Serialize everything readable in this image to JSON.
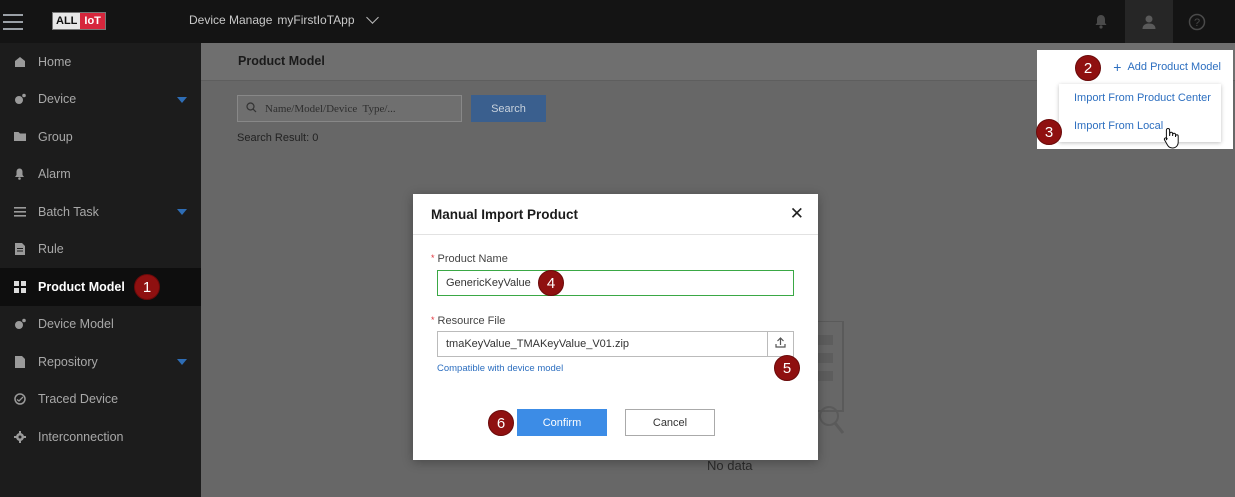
{
  "header": {
    "logo_left": "ALL",
    "logo_right": "IoT",
    "section": "Device Manage",
    "app_name": "myFirstIoTApp"
  },
  "sidebar": {
    "items": [
      {
        "label": "Home",
        "icon": "home-icon"
      },
      {
        "label": "Device",
        "icon": "device-icon",
        "expandable": true
      },
      {
        "label": "Group",
        "icon": "folder-icon"
      },
      {
        "label": "Alarm",
        "icon": "bell-icon"
      },
      {
        "label": "Batch Task",
        "icon": "list-icon",
        "expandable": true
      },
      {
        "label": "Rule",
        "icon": "document-icon"
      },
      {
        "label": "Product Model",
        "icon": "grid-icon",
        "active": true
      },
      {
        "label": "Device Model",
        "icon": "device-model-icon"
      },
      {
        "label": "Repository",
        "icon": "repository-icon",
        "expandable": true
      },
      {
        "label": "Traced Device",
        "icon": "trace-icon"
      },
      {
        "label": "Interconnection",
        "icon": "gear-icon"
      }
    ]
  },
  "main": {
    "page_title": "Product Model",
    "search_placeholder": "Name/Model/Device  Type/...",
    "search_button": "Search",
    "search_result": "Search Result: 0",
    "no_data": "No data"
  },
  "add_menu": {
    "add_label": "Add Product Model",
    "items": [
      "Import From Product Center",
      "Import From Local"
    ]
  },
  "modal": {
    "title": "Manual Import Product",
    "product_name_label": "Product Name",
    "product_name_value": "GenericKeyValue",
    "resource_file_label": "Resource File",
    "resource_file_value": "tmaKeyValue_TMAKeyValue_V01.zip",
    "hint": "Compatible with device model",
    "confirm": "Confirm",
    "cancel": "Cancel"
  },
  "markers": [
    "1",
    "2",
    "3",
    "4",
    "5",
    "6"
  ],
  "colors": {
    "accent": "#3c8ce6",
    "marker": "#8f1010",
    "link": "#2d6fc0"
  }
}
